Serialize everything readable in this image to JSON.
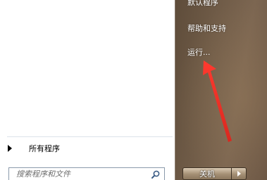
{
  "left_pane": {
    "all_programs_label": "所有程序",
    "search_placeholder": "搜索程序和文件"
  },
  "right_pane": {
    "items": [
      {
        "label": "默认程序"
      },
      {
        "label": "帮助和支持"
      },
      {
        "label": "运行..."
      }
    ],
    "shutdown_label": "关机"
  },
  "colors": {
    "annotation_arrow": "#e8322a",
    "right_pane_bg": "#6f5b47"
  },
  "icons": {
    "search": "search-icon",
    "all_programs_arrow": "triangle-right-icon",
    "shutdown_options": "triangle-right-icon"
  }
}
